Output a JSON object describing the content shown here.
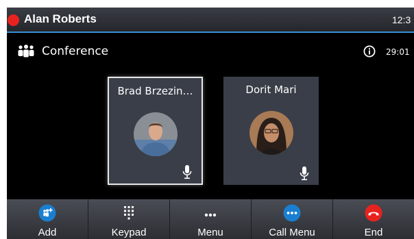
{
  "status_bar": {
    "user_name": "Alan Roberts",
    "time": "12:3",
    "status_color": "#e8231f"
  },
  "conference": {
    "label": "Conference",
    "icon": "conference-icon",
    "timer": "29:01",
    "info_icon": "info-icon"
  },
  "participants": [
    {
      "name": "Brad Brzezin…",
      "icon": "microphone-icon",
      "selected": true
    },
    {
      "name": "Dorit Mari",
      "icon": "microphone-icon",
      "selected": false
    }
  ],
  "softkeys": [
    {
      "label": "Add",
      "icon": "add-participant-icon"
    },
    {
      "label": "Keypad",
      "icon": "keypad-icon"
    },
    {
      "label": "Menu",
      "icon": "menu-dots-icon"
    },
    {
      "label": "Call Menu",
      "icon": "call-menu-icon"
    },
    {
      "label": "End",
      "icon": "end-call-icon"
    }
  ],
  "colors": {
    "accent": "#3a8fd6",
    "softkey_blue": "#1a7fd1",
    "end_red": "#e8231f"
  }
}
